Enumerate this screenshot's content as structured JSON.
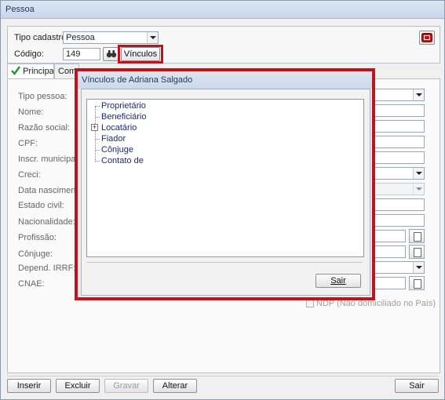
{
  "window": {
    "title": "Pessoa"
  },
  "header": {
    "tipo_cadastro_label": "Tipo cadastro",
    "tipo_cadastro_value": "Pessoa",
    "codigo_label": "Código:",
    "codigo_value": "149",
    "vinculos_button": "Vínculos"
  },
  "tabs": [
    {
      "label": "Principal"
    },
    {
      "label": "Comp"
    }
  ],
  "form": {
    "labels": [
      "Tipo pessoa:",
      "Nome:",
      "Razão social:",
      "CPF:",
      "Inscr. municipal:",
      "Creci:",
      "Data nascimento",
      "Estado civil:",
      "Nacionalidade:",
      "Profissão:",
      "Cônjuge:",
      "Depend. IRRF:",
      "CNAE:"
    ],
    "ndp_label": "NDP (Não domiciliado no País)"
  },
  "dialog": {
    "title": "Vínculos de Adriana Salgado",
    "tree_items": [
      "Proprietário",
      "Beneficiário",
      "Locatário",
      "Fiador",
      "Cônjuge",
      "Contato de"
    ],
    "expander_symbol": "+",
    "close_button": "Sair"
  },
  "footer": {
    "inserir": "Inserir",
    "excluir": "Excluir",
    "gravar": "Gravar",
    "alterar": "Alterar",
    "sair": "Sair"
  },
  "colors": {
    "highlight": "#c0141c",
    "check": "#1a9a2a"
  }
}
